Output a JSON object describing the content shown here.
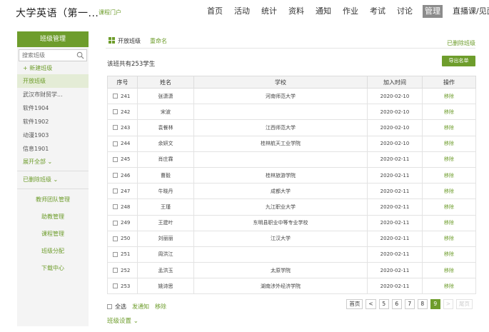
{
  "header": {
    "course_title": "大学英语（第一...",
    "portal_link": "课程门户",
    "nav": [
      {
        "label": "首页",
        "name": "nav-home",
        "active": false
      },
      {
        "label": "活动",
        "name": "nav-activity",
        "active": false
      },
      {
        "label": "统计",
        "name": "nav-statistics",
        "active": false
      },
      {
        "label": "资料",
        "name": "nav-materials",
        "active": false
      },
      {
        "label": "通知",
        "name": "nav-notice",
        "active": false
      },
      {
        "label": "作业",
        "name": "nav-homework",
        "active": false
      },
      {
        "label": "考试",
        "name": "nav-exam",
        "active": false
      },
      {
        "label": "讨论",
        "name": "nav-discussion",
        "active": false
      },
      {
        "label": "管理",
        "name": "nav-manage",
        "active": true
      },
      {
        "label": "直播课/见面课",
        "name": "nav-live",
        "active": false
      }
    ]
  },
  "sidebar": {
    "title": "班级管理",
    "search_placeholder": "搜索班级",
    "new_class": "+ 新建班级",
    "classes": [
      "开放班级",
      "武汉市财贸学...",
      "软件1904",
      "软件1902",
      "动漫1903",
      "信息1901"
    ],
    "expand_all": "展开全部 ⌄",
    "deleted_classes": "已删除班级 ⌄",
    "links": [
      "教师团队管理",
      "助教管理",
      "课程管理",
      "班级分配",
      "下载中心"
    ]
  },
  "main": {
    "class_name": "开放班级",
    "rename": "重命名",
    "deleted_classes_link": "已删除班级",
    "summary": "该班共有253学生",
    "export_button": "导出名单",
    "columns": [
      "序号",
      "姓名",
      "学校",
      "加入时间",
      "操作"
    ],
    "rows": [
      {
        "seq": "241",
        "name": "张潇潇",
        "school": "河南师范大学",
        "date": "2020-02-10",
        "action": "移除"
      },
      {
        "seq": "242",
        "name": "宋波",
        "school": "",
        "date": "2020-02-10",
        "action": "移除"
      },
      {
        "seq": "243",
        "name": "袁餐林",
        "school": "江西师范大学",
        "date": "2020-02-10",
        "action": "移除"
      },
      {
        "seq": "244",
        "name": "余妍文",
        "school": "桂林航天工业学院",
        "date": "2020-02-10",
        "action": "移除"
      },
      {
        "seq": "245",
        "name": "肖庄霖",
        "school": "",
        "date": "2020-02-11",
        "action": "移除"
      },
      {
        "seq": "246",
        "name": "曹毅",
        "school": "桂林旅游学院",
        "date": "2020-02-11",
        "action": "移除"
      },
      {
        "seq": "247",
        "name": "牛晓丹",
        "school": "成都大学",
        "date": "2020-02-11",
        "action": "移除"
      },
      {
        "seq": "248",
        "name": "王瑾",
        "school": "九江职业大学",
        "date": "2020-02-11",
        "action": "移除"
      },
      {
        "seq": "249",
        "name": "王建叶",
        "school": "东明县职业中等专业学校",
        "date": "2020-02-11",
        "action": "移除"
      },
      {
        "seq": "250",
        "name": "刘丽丽",
        "school": "江汉大学",
        "date": "2020-02-11",
        "action": "移除"
      },
      {
        "seq": "251",
        "name": "周洪江",
        "school": "",
        "date": "2020-02-11",
        "action": "移除"
      },
      {
        "seq": "252",
        "name": "孟洪玉",
        "school": "太原学院",
        "date": "2020-02-11",
        "action": "移除"
      },
      {
        "seq": "253",
        "name": "姚诗思",
        "school": "湖南涉外经济学院",
        "date": "2020-02-11",
        "action": "移除"
      }
    ],
    "select_all": "全选",
    "notify": "发通知",
    "remove": "移除",
    "pager": [
      {
        "label": "首页",
        "state": "normal"
      },
      {
        "label": "<",
        "state": "normal"
      },
      {
        "label": "5",
        "state": "normal"
      },
      {
        "label": "6",
        "state": "normal"
      },
      {
        "label": "7",
        "state": "normal"
      },
      {
        "label": "8",
        "state": "normal"
      },
      {
        "label": "9",
        "state": "active"
      },
      {
        "label": ">",
        "state": "disabled"
      },
      {
        "label": "尾页",
        "state": "disabled"
      }
    ],
    "class_settings": "班级设置 ⌄"
  },
  "colors": {
    "accent": "#6e9d2c",
    "active_nav": "#8c8c8c"
  }
}
